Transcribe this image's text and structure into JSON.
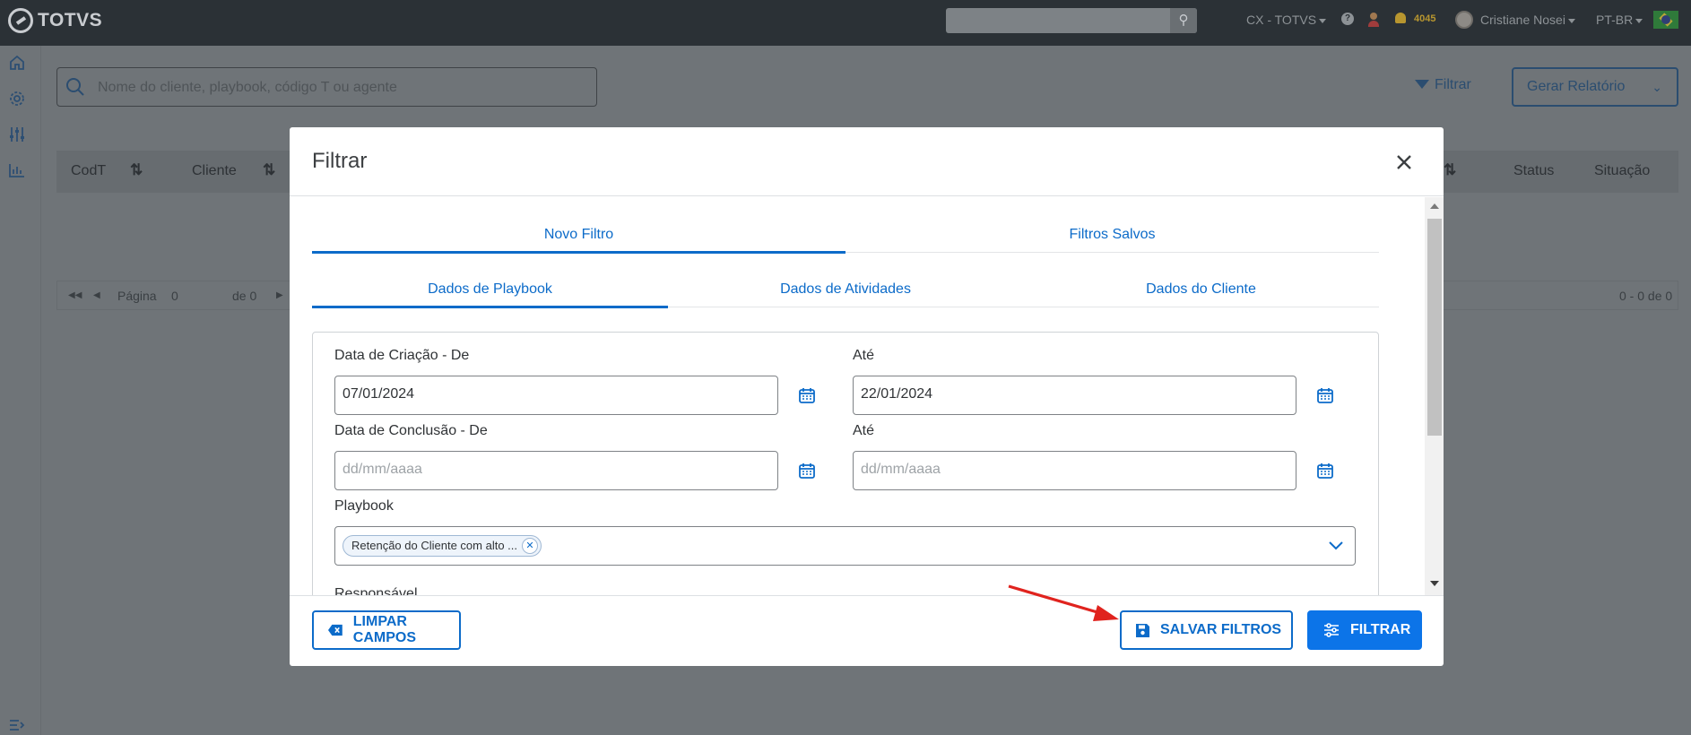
{
  "topbar": {
    "logo_text": "TOTVS",
    "search_placeholder": "",
    "company": "CX - TOTVS",
    "notification_count": "4045",
    "user_name": "Cristiane Nosei",
    "language": "PT-BR"
  },
  "background": {
    "search_placeholder": "Nome do cliente, playbook, código T ou agente",
    "filter_link": "Filtrar",
    "report_button": "Gerar Relatório",
    "columns": [
      "CodT",
      "Cliente",
      "Status",
      "Situação"
    ],
    "pager": {
      "page_label": "Página",
      "page_value": "0",
      "of_label": "de 0",
      "range": "0 - 0 de 0"
    }
  },
  "modal": {
    "title": "Filtrar",
    "tabs_primary": [
      {
        "label": "Novo Filtro",
        "active": true
      },
      {
        "label": "Filtros Salvos",
        "active": false
      }
    ],
    "tabs_secondary": [
      {
        "label": "Dados de Playbook",
        "active": true
      },
      {
        "label": "Dados de Atividades",
        "active": false
      },
      {
        "label": "Dados do Cliente",
        "active": false
      }
    ],
    "form": {
      "creation_from_label": "Data de Criação - De",
      "creation_from_value": "07/01/2024",
      "creation_to_label": "Até",
      "creation_to_value": "22/01/2024",
      "conclusion_from_label": "Data de Conclusão - De",
      "conclusion_from_placeholder": "dd/mm/aaaa",
      "conclusion_to_label": "Até",
      "conclusion_to_placeholder": "dd/mm/aaaa",
      "playbook_label": "Playbook",
      "playbook_chip": "Retenção do Cliente com alto ...",
      "responsible_label": "Responsável"
    },
    "footer": {
      "clear_button": "LIMPAR CAMPOS",
      "save_button": "SALVAR FILTROS",
      "filter_button": "FILTRAR"
    }
  },
  "colors": {
    "accent": "#0c74e8",
    "link": "#0c6bc9",
    "annotation_arrow": "#e0231e"
  }
}
